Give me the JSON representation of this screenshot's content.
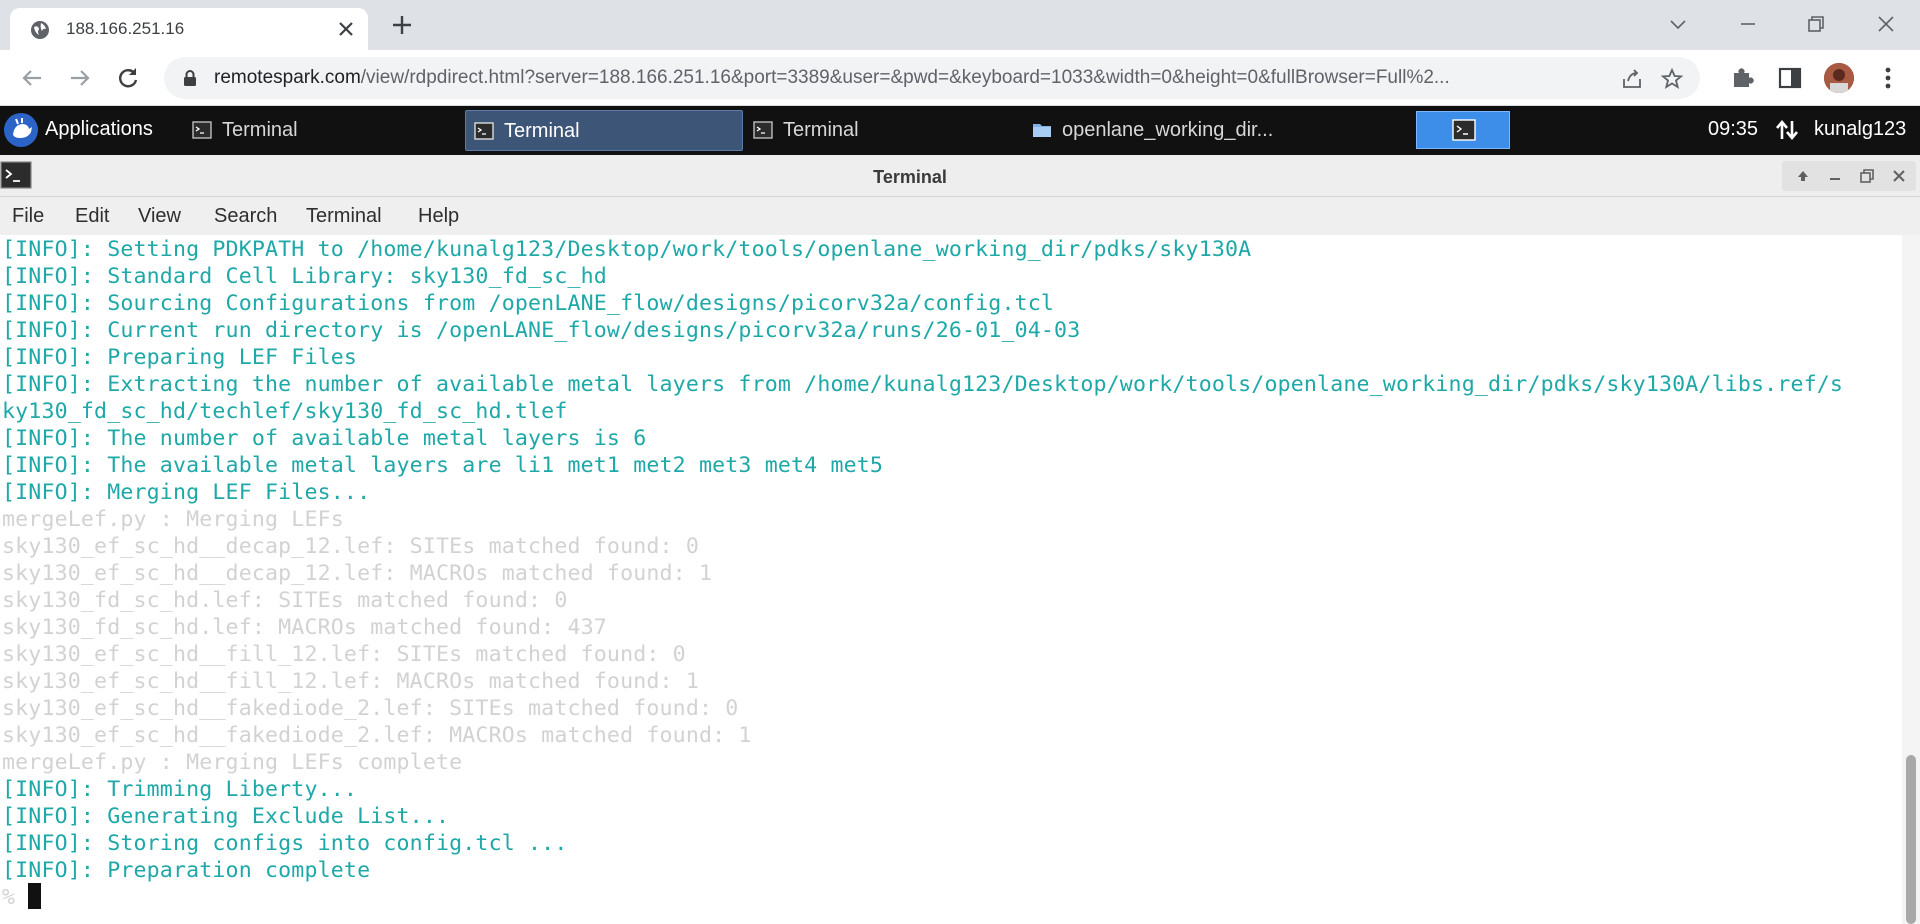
{
  "browser": {
    "tab_title": "188.166.251.16",
    "url_host": "remotespark.com",
    "url_path": "/view/rdpdirect.html?server=188.166.251.16&port=3389&user=&pwd=&keyboard=1033&width=0&height=0&fullBrowser=Full%2..."
  },
  "panel": {
    "applications_label": "Applications",
    "tasks": [
      {
        "label": "Terminal"
      },
      {
        "label": "Terminal"
      },
      {
        "label": "Terminal"
      },
      {
        "label": "openlane_working_dir..."
      }
    ],
    "clock": "09:35",
    "user": "kunalg123"
  },
  "window": {
    "title": "Terminal",
    "menu": [
      "File",
      "Edit",
      "View",
      "Search",
      "Terminal",
      "Help"
    ]
  },
  "terminal": {
    "lines": [
      {
        "text": "[INFO]: Setting PDKPATH to /home/kunalg123/Desktop/work/tools/openlane_working_dir/pdks/sky130A",
        "style": "info"
      },
      {
        "text": "[INFO]: Standard Cell Library: sky130_fd_sc_hd",
        "style": "info"
      },
      {
        "text": "[INFO]: Sourcing Configurations from /openLANE_flow/designs/picorv32a/config.tcl",
        "style": "info"
      },
      {
        "text": "[INFO]: Current run directory is /openLANE_flow/designs/picorv32a/runs/26-01_04-03",
        "style": "info"
      },
      {
        "text": "[INFO]: Preparing LEF Files",
        "style": "info"
      },
      {
        "text": "[INFO]: Extracting the number of available metal layers from /home/kunalg123/Desktop/work/tools/openlane_working_dir/pdks/sky130A/libs.ref/s",
        "style": "info"
      },
      {
        "text": "ky130_fd_sc_hd/techlef/sky130_fd_sc_hd.tlef",
        "style": "info"
      },
      {
        "text": "[INFO]: The number of available metal layers is 6",
        "style": "info"
      },
      {
        "text": "[INFO]: The available metal layers are li1 met1 met2 met3 met4 met5",
        "style": "info"
      },
      {
        "text": "[INFO]: Merging LEF Files...",
        "style": "info"
      },
      {
        "text": "mergeLef.py : Merging LEFs",
        "style": "dim"
      },
      {
        "text": "sky130_ef_sc_hd__decap_12.lef: SITEs matched found: 0",
        "style": "dim"
      },
      {
        "text": "sky130_ef_sc_hd__decap_12.lef: MACROs matched found: 1",
        "style": "dim"
      },
      {
        "text": "sky130_fd_sc_hd.lef: SITEs matched found: 0",
        "style": "dim"
      },
      {
        "text": "sky130_fd_sc_hd.lef: MACROs matched found: 437",
        "style": "dim"
      },
      {
        "text": "sky130_ef_sc_hd__fill_12.lef: SITEs matched found: 0",
        "style": "dim"
      },
      {
        "text": "sky130_ef_sc_hd__fill_12.lef: MACROs matched found: 1",
        "style": "dim"
      },
      {
        "text": "sky130_ef_sc_hd__fakediode_2.lef: SITEs matched found: 0",
        "style": "dim"
      },
      {
        "text": "sky130_ef_sc_hd__fakediode_2.lef: MACROs matched found: 1",
        "style": "dim"
      },
      {
        "text": "mergeLef.py : Merging LEFs complete",
        "style": "dim"
      },
      {
        "text": "[INFO]: Trimming Liberty...",
        "style": "info"
      },
      {
        "text": "[INFO]: Generating Exclude List...",
        "style": "info"
      },
      {
        "text": "[INFO]: Storing configs into config.tcl ...",
        "style": "info"
      },
      {
        "text": "[INFO]: Preparation complete",
        "style": "info"
      },
      {
        "text": "% ",
        "style": "dim"
      }
    ]
  },
  "colors": {
    "info_text": "#1fa8a8",
    "dim_text": "#d2d2d2",
    "panel_bg": "#111111",
    "workspace_active": "#3d8ee8"
  },
  "icons": {
    "tab": "globe-icon",
    "close": "close-icon",
    "new_tab": "plus-icon",
    "back": "arrow-left-icon",
    "forward": "arrow-right-icon",
    "reload": "reload-icon",
    "lock": "lock-icon",
    "share": "share-icon",
    "bookmark": "star-icon",
    "extensions": "puzzle-icon",
    "sidepanel": "side-panel-icon",
    "menu": "kebab-menu-icon",
    "terminal": "terminal-icon",
    "folder": "folder-icon",
    "network": "network-icon"
  }
}
